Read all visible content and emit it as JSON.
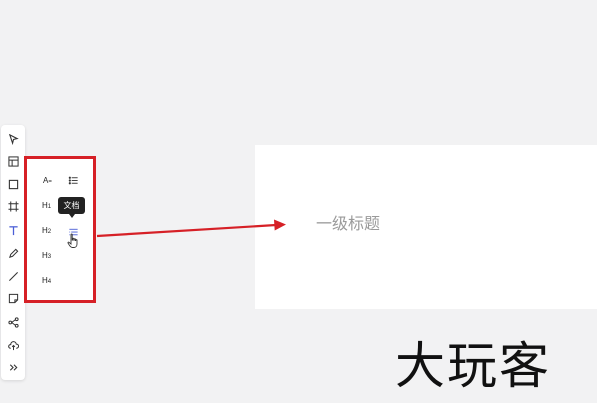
{
  "toolbar": {
    "tools": [
      {
        "name": "select-tool",
        "icon": "cursor-arrow-icon"
      },
      {
        "name": "table-tool",
        "icon": "table-icon"
      },
      {
        "name": "shape-tool",
        "icon": "square-icon"
      },
      {
        "name": "frame-tool",
        "icon": "frame-icon"
      },
      {
        "name": "text-tool",
        "icon": "text-icon",
        "active": true
      },
      {
        "name": "pen-tool",
        "icon": "pen-icon"
      },
      {
        "name": "line-tool",
        "icon": "line-icon"
      },
      {
        "name": "sticky-note-tool",
        "icon": "sticky-note-icon"
      },
      {
        "name": "connector-tool",
        "icon": "connector-icon"
      },
      {
        "name": "upload-tool",
        "icon": "upload-cloud-icon"
      },
      {
        "name": "more-tool",
        "icon": "double-chevron-icon"
      }
    ],
    "accent": "#4b5fd6"
  },
  "text_panel": {
    "items": {
      "text": {
        "main": "A",
        "suffix": "="
      },
      "h1": {
        "main": "H",
        "sub": "1"
      },
      "h2": {
        "main": "H",
        "sub": "2"
      },
      "h3": {
        "main": "H",
        "sub": "3"
      },
      "h4": {
        "main": "H",
        "sub": "4"
      }
    },
    "tooltip": "文档",
    "highlight_color": "#d62026"
  },
  "canvas": {
    "heading": "一级标题"
  },
  "watermark": "大玩客"
}
